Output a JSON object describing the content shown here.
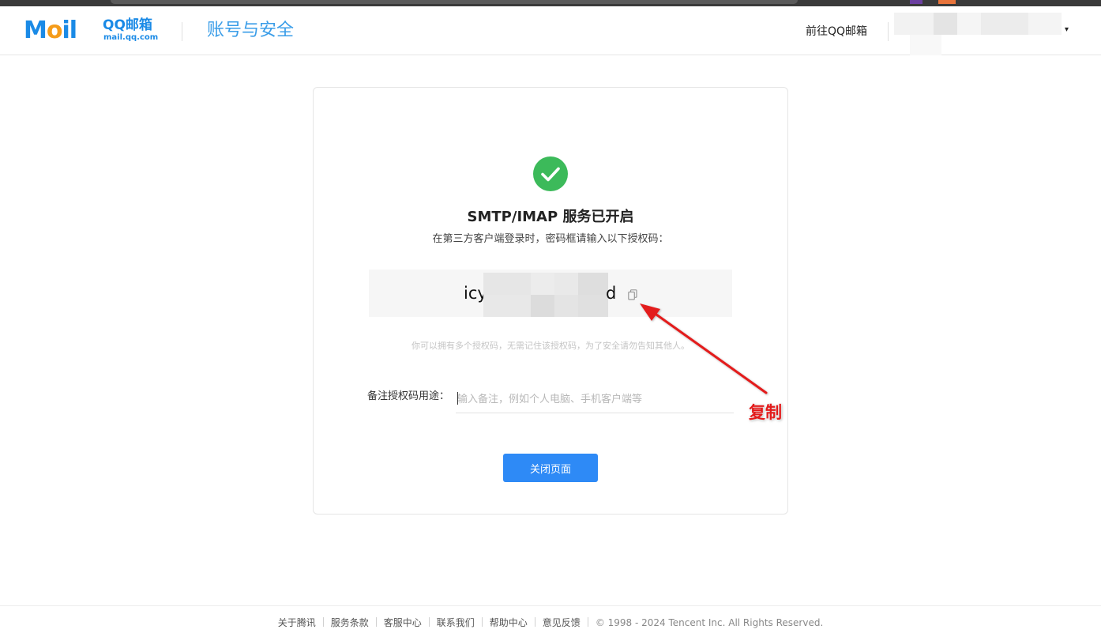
{
  "header": {
    "logo_word_left": "M",
    "logo_word_mid": "o",
    "logo_word_right": "il",
    "logo_cn": "QQ邮箱",
    "logo_domain": "mail.qq.com",
    "title": "账号与安全",
    "goto_label": "前往QQ邮箱",
    "account_caret": "▾"
  },
  "card": {
    "title": "SMTP/IMAP 服务已开启",
    "subtitle": "在第三方客户端登录时，密码框请输入以下授权码：",
    "code_prefix": "icy",
    "code_suffix": "d",
    "hint": "你可以拥有多个授权码，无需记住该授权码，为了安全请勿告知其他人。",
    "note_label": "备注授权码用途：",
    "note_placeholder": "输入备注，例如个人电脑、手机客户端等",
    "note_value": "",
    "close_button": "关闭页面"
  },
  "annotation": {
    "label": "复制",
    "color": "#e31b1b"
  },
  "footer": {
    "links": [
      "关于腾讯",
      "服务条款",
      "客服中心",
      "联系我们",
      "帮助中心",
      "意见反馈"
    ],
    "copyright": "© 1998 - 2024 Tencent Inc. All Rights Reserved."
  },
  "colors": {
    "brand_blue": "#1a8ae6",
    "success_green": "#3cba5a",
    "primary_button": "#2e8af6"
  }
}
